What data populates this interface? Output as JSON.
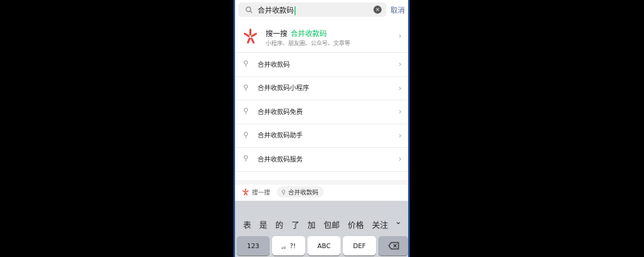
{
  "search": {
    "value": "合并收款码",
    "cancel_label": "取消"
  },
  "sousou": {
    "title": "搜一搜",
    "keyword": "合并收款码",
    "subtitle": "小程序、朋友圈、公众号、文章等"
  },
  "suggestions": [
    {
      "label": "合并收款码"
    },
    {
      "label": "合并收款码小程序"
    },
    {
      "label": "合并收款码免费"
    },
    {
      "label": "合并收款码助手"
    },
    {
      "label": "合并收款码服务"
    }
  ],
  "bottom": {
    "label": "搜一搜",
    "pill": "合并收款码"
  },
  "keyboard": {
    "candidates": [
      "表",
      "是",
      "的",
      "了",
      "加",
      "包邮",
      "价格",
      "关注"
    ],
    "keys": {
      "num": "123",
      "punct": ",。?!",
      "abc": "ABC",
      "def": "DEF"
    }
  },
  "colors": {
    "accent": "#07c160",
    "link": "#576b95",
    "logo": "#e64340"
  }
}
